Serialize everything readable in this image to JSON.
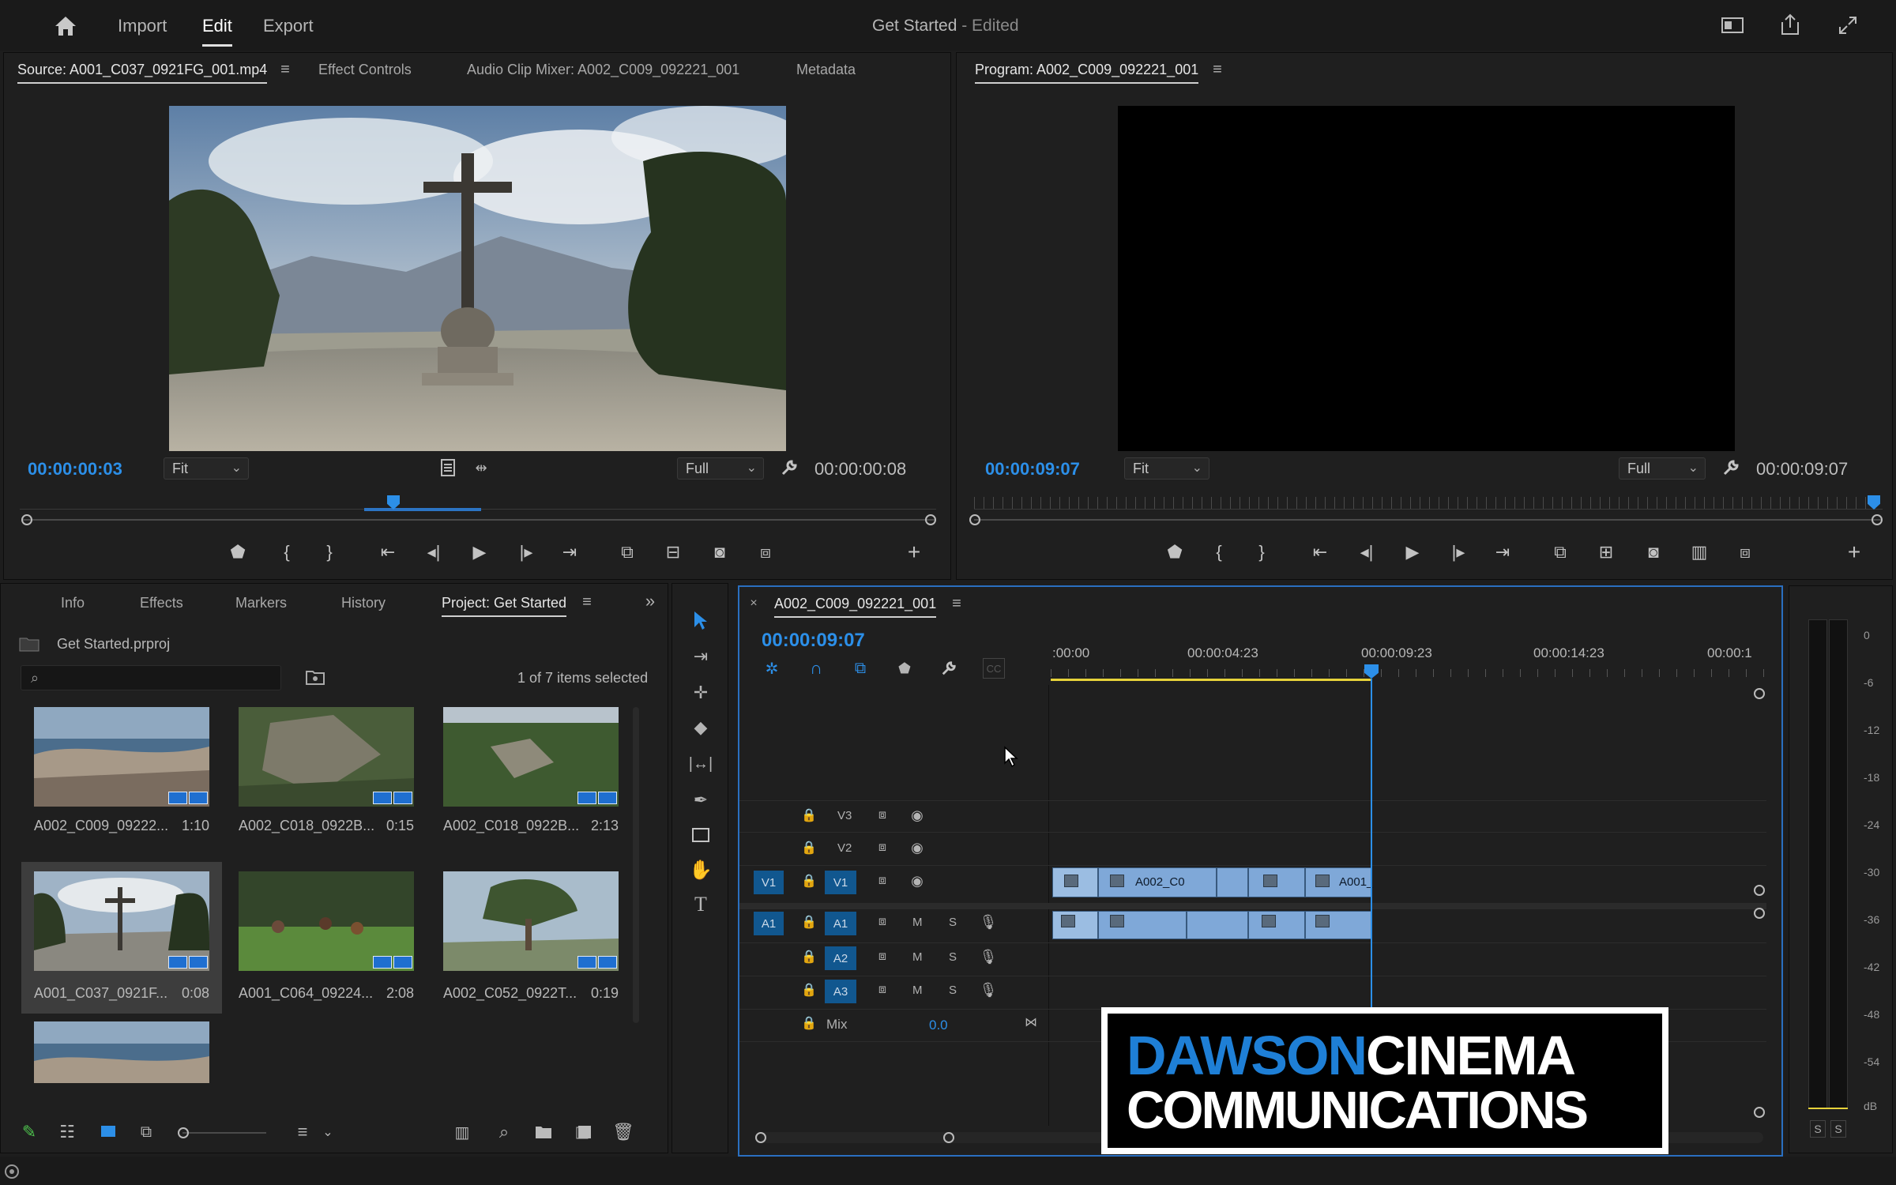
{
  "menubar": {
    "import": "Import",
    "edit": "Edit",
    "export": "Export",
    "title": "Get Started",
    "title_suffix": " - Edited"
  },
  "source_panel": {
    "tabs": [
      "Source: A001_C037_0921FG_001.mp4",
      "Effect Controls",
      "Audio Clip Mixer: A002_C009_092221_001",
      "Metadata"
    ],
    "timecode_in": "00:00:00:03",
    "timecode_duration": "00:00:00:08",
    "zoom": "Fit",
    "resolution": "Full"
  },
  "program_panel": {
    "tab": "Program: A002_C009_092221_001",
    "timecode_in": "00:00:09:07",
    "timecode_duration": "00:00:09:07",
    "zoom": "Fit",
    "resolution": "Full"
  },
  "project_panel": {
    "tabs": [
      "Info",
      "Effects",
      "Markers",
      "History",
      "Project: Get Started"
    ],
    "file": "Get Started.prproj",
    "count": "1 of 7 items selected",
    "items": [
      {
        "name": "A002_C009_09222...",
        "duration": "1:10"
      },
      {
        "name": "A002_C018_0922B...",
        "duration": "0:15"
      },
      {
        "name": "A002_C018_0922B...",
        "duration": "2:13"
      },
      {
        "name": "A001_C037_0921F...",
        "duration": "0:08"
      },
      {
        "name": "A001_C064_09224...",
        "duration": "2:08"
      },
      {
        "name": "A002_C052_0922T...",
        "duration": "0:19"
      }
    ]
  },
  "timeline": {
    "tab": "A002_C009_092221_001",
    "timecode": "00:00:09:07",
    "ruler": [
      ":00:00",
      "00:00:04:23",
      "00:00:09:23",
      "00:00:14:23",
      "00:00:1"
    ],
    "video_tracks": [
      "V3",
      "V2",
      "V1"
    ],
    "audio_tracks": [
      "A1",
      "A2",
      "A3"
    ],
    "source_v": "V1",
    "source_a": "A1",
    "mute": "M",
    "solo": "S",
    "mix_label": "Mix",
    "mix_value": "0.0",
    "clip_labels": [
      "A002_C0",
      "A001_"
    ]
  },
  "meters": {
    "labels": [
      "0",
      "-6",
      "-12",
      "-18",
      "-24",
      "-30",
      "-36",
      "-42",
      "-48",
      "-54",
      "dB"
    ],
    "solo": [
      "S",
      "S"
    ]
  },
  "watermark": {
    "line1_blue": "DAWSON",
    "line1_white": "CINEMA",
    "line2": "COMMUNICATIONS"
  },
  "colors": {
    "accent": "#2c8fe8",
    "panel": "#1f1f1f",
    "clip": "#7fa8d8",
    "playhead": "#2c8fe8"
  }
}
